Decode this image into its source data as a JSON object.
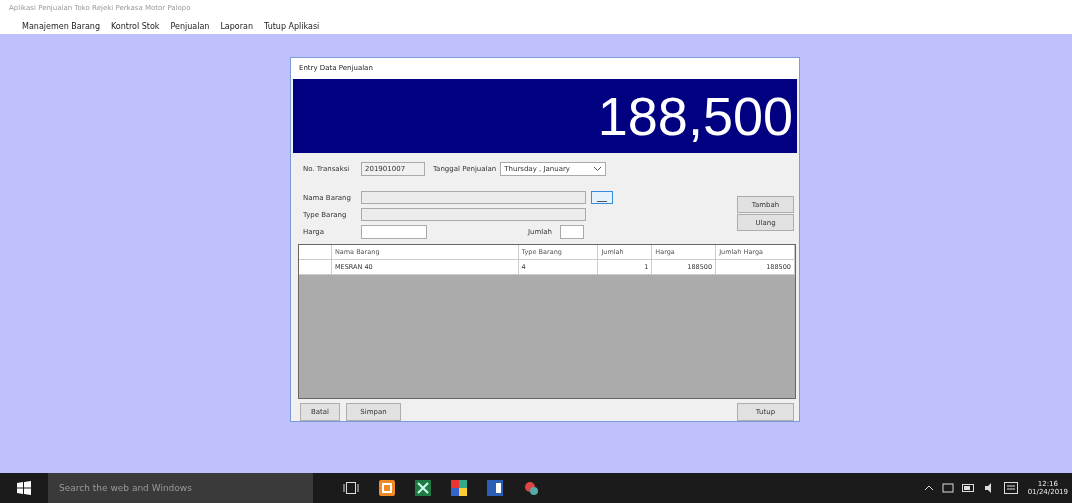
{
  "window": {
    "title": "Aplikasi Penjualan Toko Rejeki Perkasa Motor Palopo"
  },
  "menu": [
    "Manajemen Barang",
    "Kontrol Stok",
    "Penjualan",
    "Laporan",
    "Tutup Aplikasi"
  ],
  "dialog": {
    "title": "Entry Data Penjualan",
    "total": "188,500",
    "no_transaksi": {
      "label": "No. Transaksi",
      "value": "201901007"
    },
    "tanggal": {
      "label": "Tanggal Penjualan",
      "value": "Thursday , January"
    },
    "nama_barang": {
      "label": "Nama Barang"
    },
    "type_barang": {
      "label": "Type Barang"
    },
    "harga": {
      "label": "Harga"
    },
    "jumlah": {
      "label": "Jumlah"
    },
    "side_buttons": [
      "Tambah",
      "Ulang"
    ],
    "table": {
      "columns": [
        "Nama Barang",
        "Type Barang",
        "Jumlah",
        "Harga",
        "Jumlah Harga"
      ],
      "rows": [
        [
          "MESRAN 40",
          "4",
          "1",
          "188500",
          "188500"
        ]
      ]
    },
    "bottom_buttons": [
      "Batal",
      "Simpan"
    ],
    "close_button": "Tutup"
  },
  "taskbar": {
    "search": {
      "placeholder": "Search the web and Windows"
    },
    "time": "12:16",
    "date": "01/24/2019"
  }
}
